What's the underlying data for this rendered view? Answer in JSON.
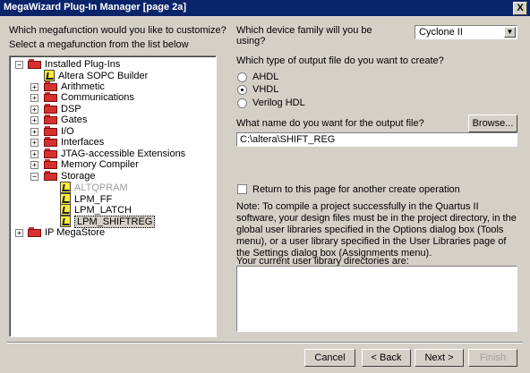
{
  "window": {
    "title": "MegaWizard Plug-In Manager [page 2a]",
    "close": "X"
  },
  "left": {
    "question": "Which megafunction would you like to customize?",
    "select_label": "Select a megafunction from the list below",
    "tree": {
      "installed": "Installed Plug-Ins",
      "items": [
        "Altera SOPC Builder",
        "Arithmetic",
        "Communications",
        "DSP",
        "Gates",
        "I/O",
        "Interfaces",
        "JTAG-accessible Extensions",
        "Memory Compiler",
        "Storage"
      ],
      "storage_children": [
        "ALTQPRAM",
        "LPM_FF",
        "LPM_LATCH",
        "LPM_SHIFTREG"
      ],
      "ip": "IP MegaStore"
    }
  },
  "right": {
    "device_q_line1": "Which device family will you be",
    "device_q_line2": "using?",
    "device_value": "Cyclone II",
    "output_q": "Which type of output file do you want to create?",
    "options": [
      "AHDL",
      "VHDL",
      "Verilog HDL"
    ],
    "name_q": "What name do you want for the output file?",
    "browse": "Browse...",
    "path": "C:\\altera\\SHIFT_REG",
    "return_label": "Return to this page for another create operation",
    "note": "Note: To compile a project successfully in the Quartus II software, your design files must be in the project directory, in the global user libraries specified in the Options dialog box (Tools menu), or a user library specified in the User Libraries page of the Settings dialog box (Assignments menu).",
    "userlib_label": "Your current user library directories are:"
  },
  "footer": {
    "cancel": "Cancel",
    "back": "< Back",
    "next": "Next >",
    "finish": "Finish"
  }
}
